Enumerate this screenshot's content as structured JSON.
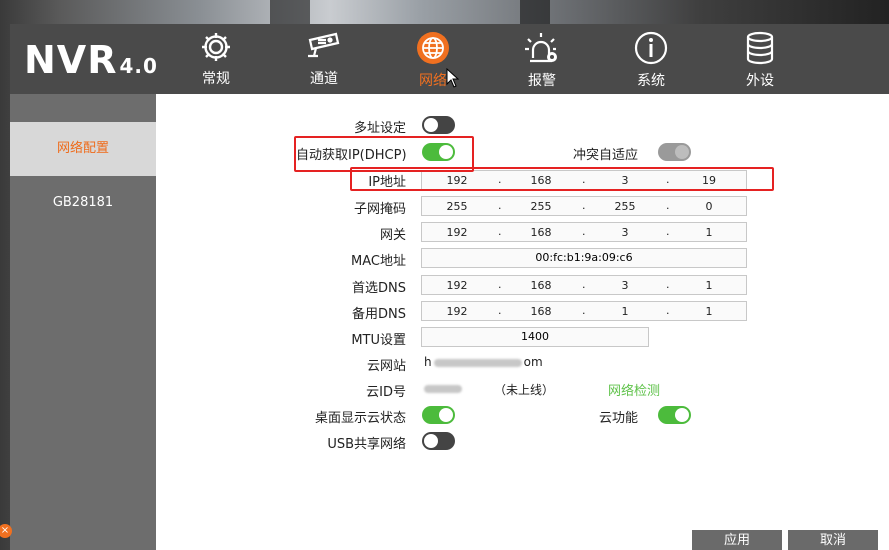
{
  "app": {
    "logo": "NVR",
    "version": "4.0"
  },
  "nav": [
    {
      "label": "常规",
      "icon": "gear-icon"
    },
    {
      "label": "通道",
      "icon": "camera-icon"
    },
    {
      "label": "网络",
      "icon": "globe-icon",
      "active": true
    },
    {
      "label": "报警",
      "icon": "alarm-icon"
    },
    {
      "label": "系统",
      "icon": "info-icon"
    },
    {
      "label": "外设",
      "icon": "database-icon"
    }
  ],
  "sidebar": {
    "items": [
      {
        "label": "网络配置",
        "active": true
      },
      {
        "label": "GB28181"
      }
    ]
  },
  "form": {
    "multi_address": {
      "label": "多址设定",
      "on": false
    },
    "dhcp": {
      "label": "自动获取IP(DHCP)",
      "on": true
    },
    "conflict": {
      "label": "冲突自适应",
      "on": true,
      "disabled": true
    },
    "ip": {
      "label": "IP地址",
      "octets": [
        "192",
        "168",
        "3",
        "19"
      ]
    },
    "mask": {
      "label": "子网掩码",
      "octets": [
        "255",
        "255",
        "255",
        "0"
      ]
    },
    "gateway": {
      "label": "网关",
      "octets": [
        "192",
        "168",
        "3",
        "1"
      ]
    },
    "mac": {
      "label": "MAC地址",
      "value": "00:fc:b1:9a:09:c6"
    },
    "dns1": {
      "label": "首选DNS",
      "octets": [
        "192",
        "168",
        "3",
        "1"
      ]
    },
    "dns2": {
      "label": "备用DNS",
      "octets": [
        "192",
        "168",
        "1",
        "1"
      ]
    },
    "mtu": {
      "label": "MTU设置",
      "value": "1400"
    },
    "cloud_site": {
      "label": "云网站",
      "value_prefix": "h",
      "value_suffix": "om"
    },
    "cloud_id": {
      "label": "云ID号",
      "status": "（未上线）",
      "check_link": "网络检测"
    },
    "desktop_cloud": {
      "label": "桌面显示云状态",
      "on": true
    },
    "cloud_func": {
      "label": "云功能",
      "on": true
    },
    "usb_share": {
      "label": "USB共享网络",
      "on": false
    }
  },
  "buttons": {
    "apply": "应用",
    "cancel": "取消"
  },
  "colors": {
    "accent": "#f07020",
    "toggle_on": "#4cbb3c",
    "highlight": "#e52222"
  }
}
